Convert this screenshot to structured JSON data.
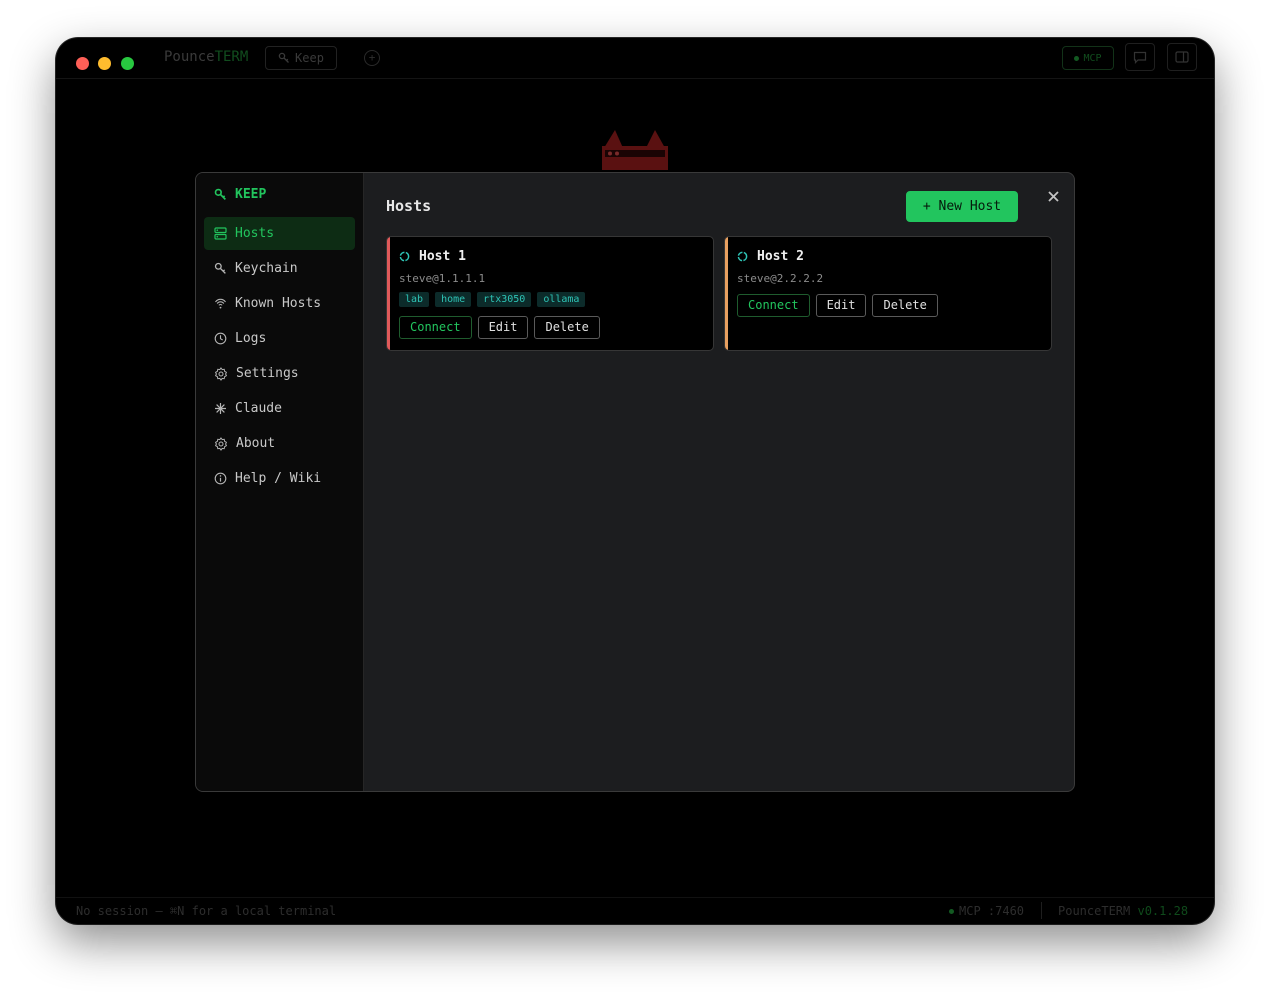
{
  "app": {
    "brand_prefix": "Pounce",
    "brand_suffix": "TERM",
    "tab_label": "Keep",
    "mcp_label": "MCP"
  },
  "statusbar": {
    "left": "No session — ⌘N for a local terminal",
    "mcp": "MCP :7460",
    "version_name": "PounceTERM",
    "version_number": "v0.1.28"
  },
  "sidebar": {
    "title": "KEEP",
    "items": [
      {
        "label": "Hosts",
        "icon": "server-icon",
        "active": true
      },
      {
        "label": "Keychain",
        "icon": "key-icon"
      },
      {
        "label": "Known Hosts",
        "icon": "fingerprint-icon"
      },
      {
        "label": "Logs",
        "icon": "clock-icon"
      },
      {
        "label": "Settings",
        "icon": "gear-icon"
      },
      {
        "label": "Claude",
        "icon": "asterisk-icon"
      },
      {
        "label": "About",
        "icon": "gear-icon"
      },
      {
        "label": "Help / Wiki",
        "icon": "info-icon"
      }
    ]
  },
  "main": {
    "title": "Hosts",
    "new_host_label": "+ New Host",
    "close_label": "×"
  },
  "hosts": [
    {
      "name": "Host 1",
      "address": "steve@1.1.1.1",
      "tags": [
        "lab",
        "home",
        "rtx3050",
        "ollama"
      ],
      "stripe_color": "#e05a5a",
      "connect_label": "Connect",
      "edit_label": "Edit",
      "delete_label": "Delete"
    },
    {
      "name": "Host 2",
      "address": "steve@2.2.2.2",
      "tags": [],
      "stripe_color": "#e8a060",
      "connect_label": "Connect",
      "edit_label": "Edit",
      "delete_label": "Delete"
    }
  ],
  "colors": {
    "accent": "#22c55e",
    "tag_text": "#2ec4b6",
    "tag_bg": "#0c2b2a"
  }
}
